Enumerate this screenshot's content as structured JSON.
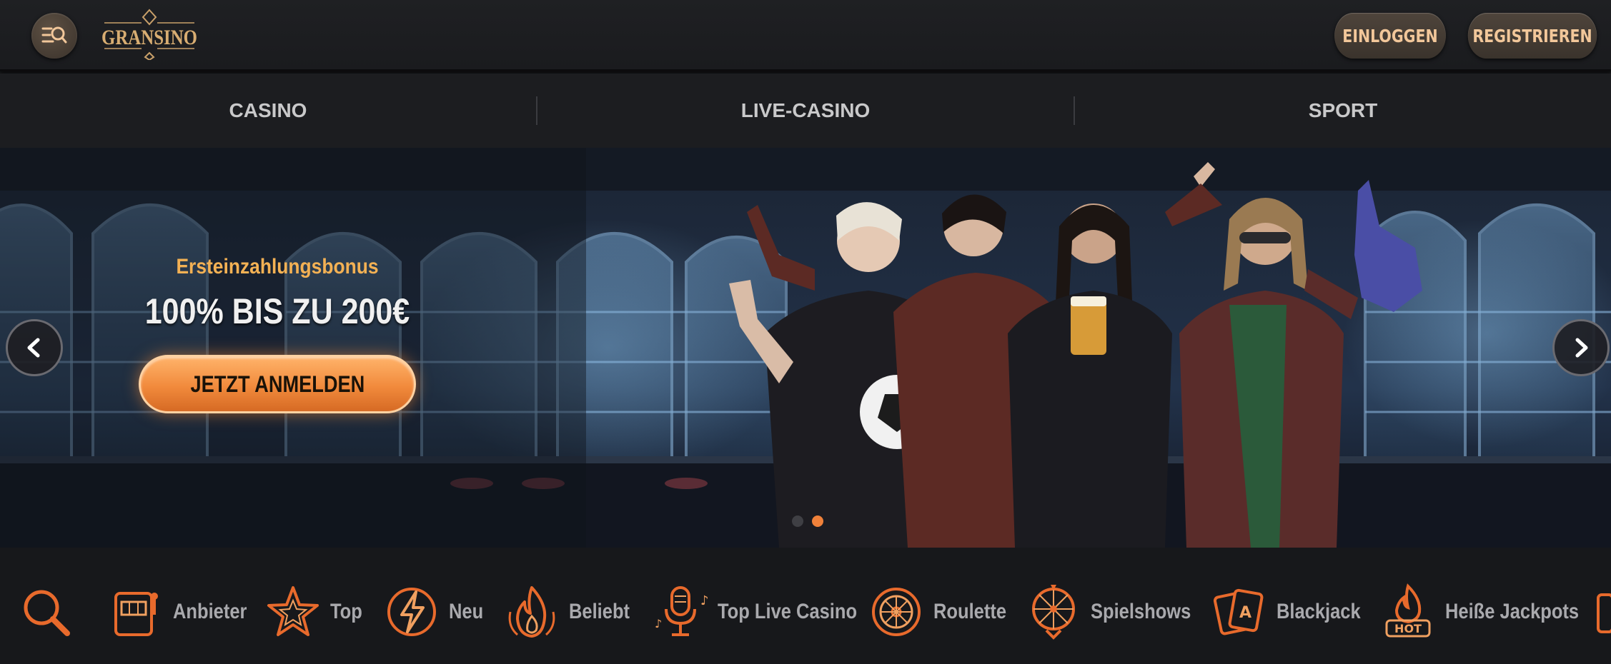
{
  "header": {
    "logo_text": "GRANSINO",
    "login_label": "EINLOGGEN",
    "register_label": "REGISTRIEREN"
  },
  "nav": {
    "tabs": [
      {
        "label": "CASINO"
      },
      {
        "label": "LIVE-CASINO"
      },
      {
        "label": "SPORT"
      }
    ]
  },
  "hero": {
    "subtitle": "Ersteinzahlungsbonus",
    "title": "100% BIS ZU 200€",
    "cta_label": "JETZT ANMELDEN",
    "active_slide": 2,
    "slide_count": 2
  },
  "categories": [
    {
      "label": "",
      "icon": "search-icon"
    },
    {
      "label": "Anbieter",
      "icon": "slot-machine-icon"
    },
    {
      "label": "Top",
      "icon": "star-icon"
    },
    {
      "label": "Neu",
      "icon": "lightning-icon"
    },
    {
      "label": "Beliebt",
      "icon": "flame-icon"
    },
    {
      "label": "Top Live Casino",
      "icon": "microphone-icon"
    },
    {
      "label": "Roulette",
      "icon": "roulette-icon"
    },
    {
      "label": "Spielshows",
      "icon": "wheel-icon"
    },
    {
      "label": "Blackjack",
      "icon": "cards-icon"
    },
    {
      "label": "Heiße Jackpots",
      "icon": "hot-icon"
    }
  ],
  "colors": {
    "accent": "#f0813a",
    "gold": "#f3b154",
    "button_text": "#f2c79a"
  }
}
